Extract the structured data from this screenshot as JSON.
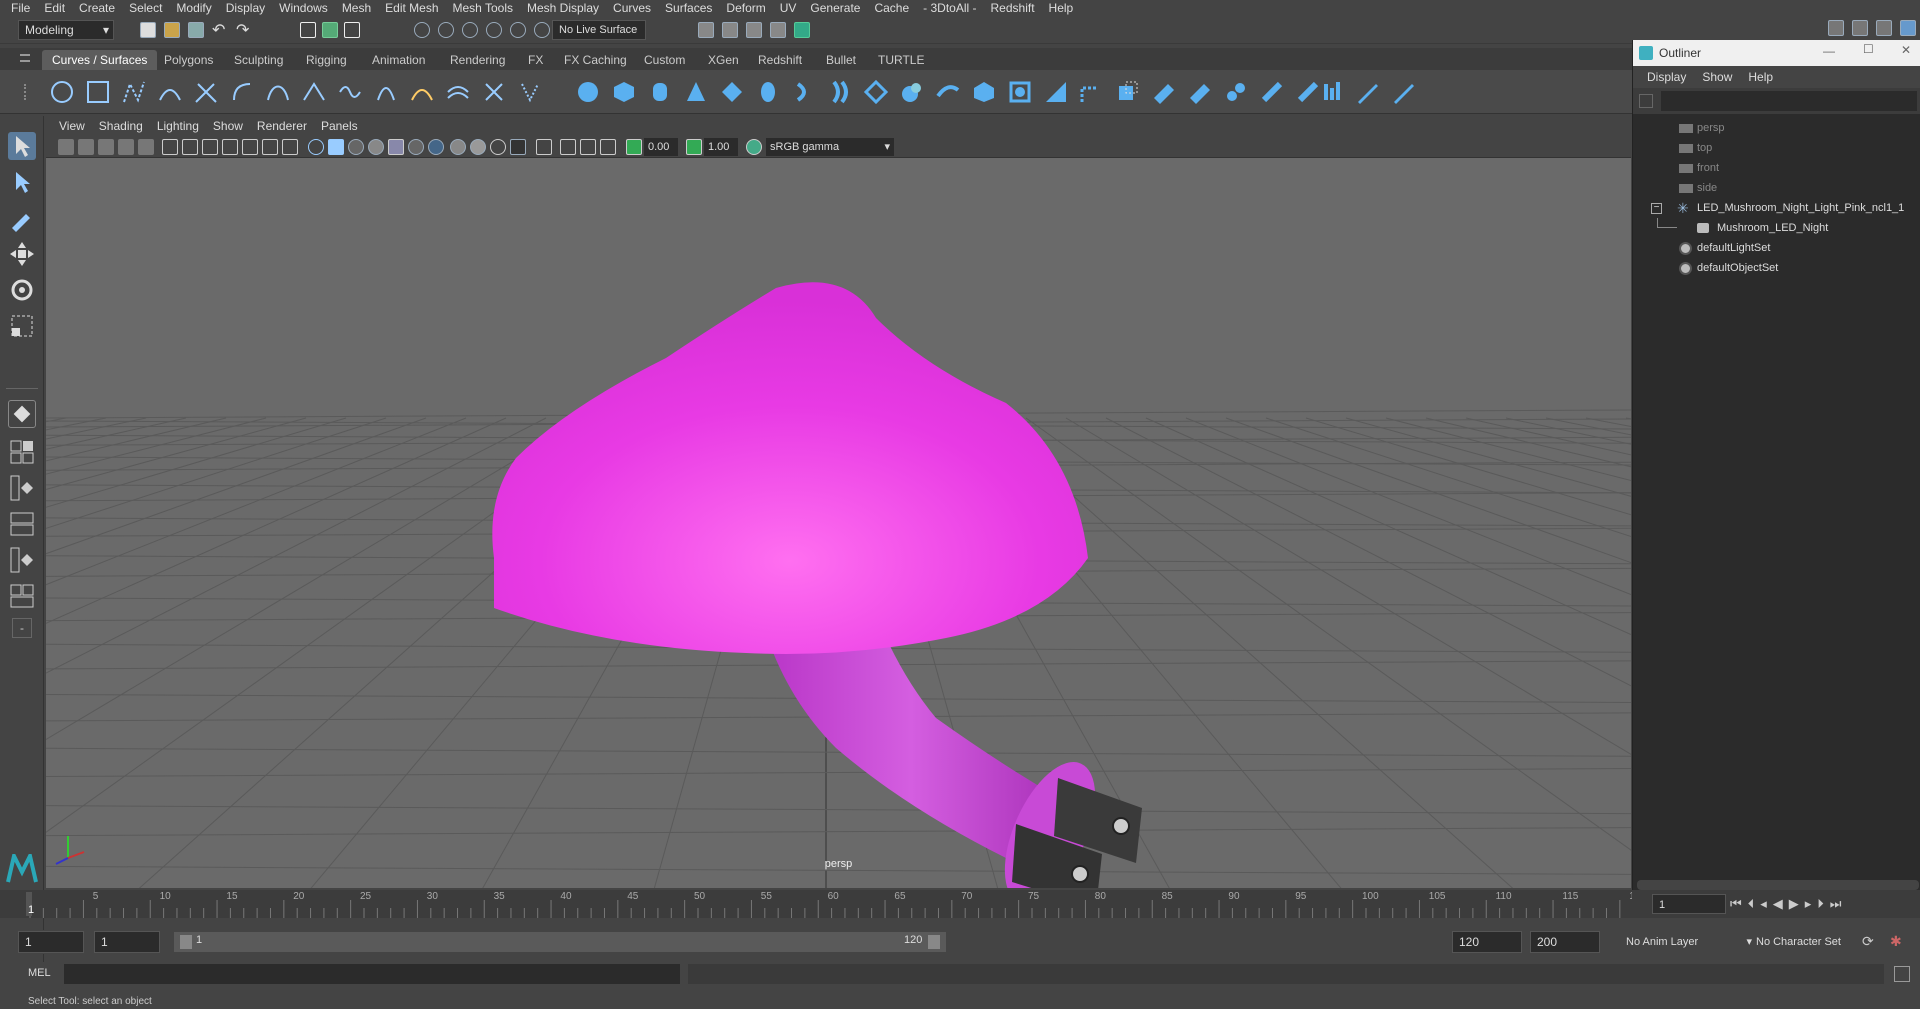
{
  "menubar": [
    "File",
    "Edit",
    "Create",
    "Select",
    "Modify",
    "Display",
    "Windows",
    "Mesh",
    "Edit Mesh",
    "Mesh Tools",
    "Mesh Display",
    "Curves",
    "Surfaces",
    "Deform",
    "UV",
    "Generate",
    "Cache",
    "- 3DtoAll -",
    "Redshift",
    "Help"
  ],
  "statusline": {
    "mode": "Modeling",
    "live_surface": "No Live Surface"
  },
  "shelf_tabs": [
    "Curves / Surfaces",
    "Polygons",
    "Sculpting",
    "Rigging",
    "Animation",
    "Rendering",
    "FX",
    "FX Caching",
    "Custom",
    "XGen",
    "Redshift",
    "Bullet",
    "TURTLE"
  ],
  "viewport": {
    "menu": [
      "View",
      "Shading",
      "Lighting",
      "Show",
      "Renderer",
      "Panels"
    ],
    "exposure": "0.00",
    "gamma": "1.00",
    "color_space": "sRGB gamma",
    "camera_label": "persp",
    "colors": {
      "mushroom": "#e040e0",
      "stem": "#c23ad0",
      "grid": "#5a5a5a",
      "bg": "#6a6a6a"
    }
  },
  "outliner": {
    "title": "Outliner",
    "menu": [
      "Display",
      "Show",
      "Help"
    ],
    "items": [
      {
        "label": "persp",
        "dim": true
      },
      {
        "label": "top",
        "dim": true
      },
      {
        "label": "front",
        "dim": true
      },
      {
        "label": "side",
        "dim": true
      },
      {
        "label": "LED_Mushroom_Night_Light_Pink_ncl1_1",
        "dim": false
      },
      {
        "label": "Mushroom_LED_Night",
        "dim": false
      },
      {
        "label": "defaultLightSet",
        "dim": false
      },
      {
        "label": "defaultObjectSet",
        "dim": false
      }
    ]
  },
  "timeline": {
    "ticks": [
      "5",
      "10",
      "15",
      "20",
      "25",
      "30",
      "35",
      "40",
      "45",
      "50",
      "55",
      "60",
      "65",
      "70",
      "75",
      "80",
      "85",
      "90",
      "95",
      "100",
      "105",
      "110",
      "115",
      "1"
    ],
    "current_frame": "1",
    "playhead": "1"
  },
  "range": {
    "start": "1",
    "start2": "1",
    "slider_start": "1",
    "slider_end": "120",
    "end": "120",
    "end2": "200",
    "anim_layer": "No Anim Layer",
    "char_set": "No Character Set"
  },
  "cmdline": {
    "label": "MEL"
  },
  "helpline": "Select Tool: select an object"
}
